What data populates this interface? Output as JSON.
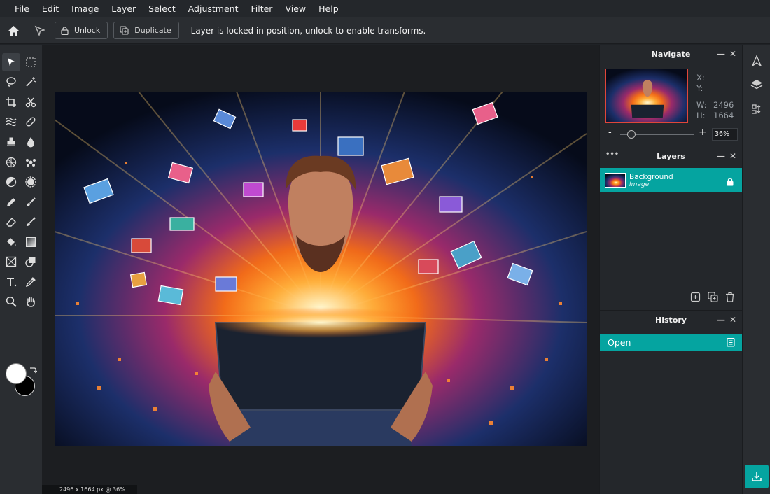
{
  "menu": [
    "File",
    "Edit",
    "Image",
    "Layer",
    "Select",
    "Adjustment",
    "Filter",
    "View",
    "Help"
  ],
  "options": {
    "unlock_label": "Unlock",
    "duplicate_label": "Duplicate",
    "message": "Layer is locked in position, unlock to enable transforms."
  },
  "tools": [
    "select-arrow",
    "marquee",
    "lasso",
    "magic-wand",
    "crop",
    "scissors",
    "liquify",
    "heal",
    "clone-stamp",
    "drop",
    "pattern",
    "spot",
    "dodge",
    "sponge",
    "pen",
    "brush",
    "eraser",
    "brush-2",
    "fill",
    "gradient",
    "frame",
    "shape",
    "type",
    "eyedropper",
    "zoom",
    "hand"
  ],
  "colors": {
    "foreground": "#ffffff",
    "background": "#000000",
    "accent": "#05a4a0",
    "nav_frame": "#e0463a"
  },
  "status": "2496 x 1664 px @ 36%",
  "navigate": {
    "title": "Navigate",
    "x_label": "X:",
    "y_label": "Y:",
    "w_label": "W:",
    "h_label": "H:",
    "w_value": "2496",
    "h_value": "1664",
    "zoom_minus": "-",
    "zoom_plus": "+",
    "zoom_value": "36%"
  },
  "layers": {
    "title": "Layers",
    "more": "•••",
    "items": [
      {
        "name": "Background",
        "type": "Image"
      }
    ]
  },
  "history": {
    "title": "History",
    "items": [
      "Open"
    ]
  }
}
